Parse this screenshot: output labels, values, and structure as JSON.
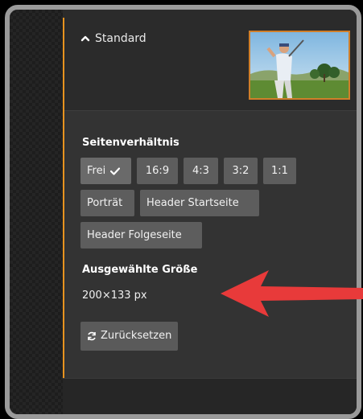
{
  "header": {
    "section_title": "Standard",
    "thumbnail": {
      "description": "golfer",
      "border_color": "#d07f2a"
    }
  },
  "aspect_ratio": {
    "label": "Seitenverhältnis",
    "options": [
      {
        "label": "Frei",
        "selected": true
      },
      {
        "label": "16:9",
        "selected": false
      },
      {
        "label": "4:3",
        "selected": false
      },
      {
        "label": "3:2",
        "selected": false
      },
      {
        "label": "1:1",
        "selected": false
      },
      {
        "label": "Porträt",
        "selected": false
      },
      {
        "label": "Header Startseite",
        "selected": false
      },
      {
        "label": "Header Folgeseite",
        "selected": false
      }
    ]
  },
  "selected_size": {
    "label": "Ausgewählte Größe",
    "value": "200×133 px"
  },
  "reset_button": {
    "label": "Zurücksetzen"
  },
  "annotation": {
    "arrow_color": "#e83a3a"
  },
  "colors": {
    "accent": "#e8931f",
    "panel_bg": "#333333",
    "button_bg": "#5d5d5d"
  }
}
